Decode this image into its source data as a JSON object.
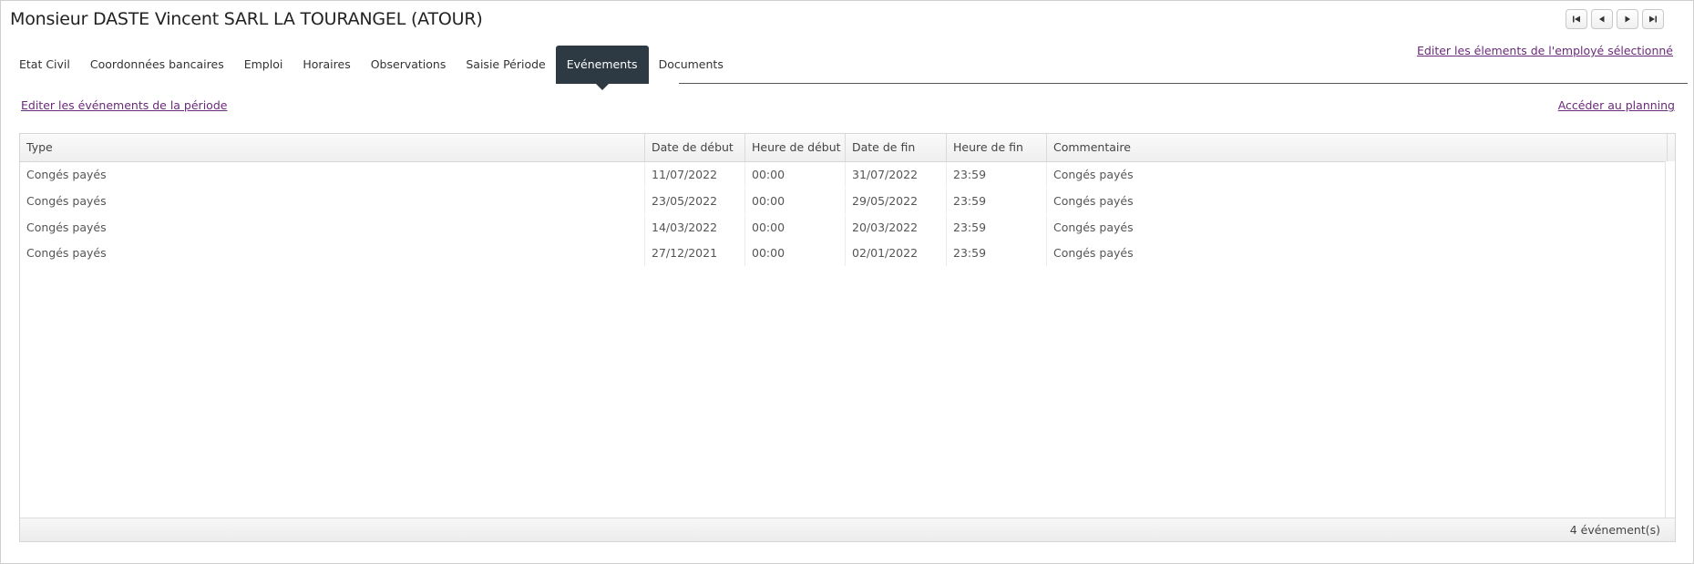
{
  "header": {
    "title": "Monsieur DASTE Vincent SARL LA TOURANGEL (ATOUR)"
  },
  "nav_buttons": [
    "first-icon",
    "previous-icon",
    "next-icon",
    "last-icon"
  ],
  "edit_employee_link": "Editer les élements de l'employé sélectionné",
  "tabs": [
    {
      "label": "Etat Civil"
    },
    {
      "label": "Coordonnées bancaires"
    },
    {
      "label": "Emploi"
    },
    {
      "label": "Horaires"
    },
    {
      "label": "Observations"
    },
    {
      "label": "Saisie Période"
    },
    {
      "label": "Evénements",
      "active": true
    },
    {
      "label": "Documents"
    }
  ],
  "links": {
    "edit_events": "Editer les événements de la période",
    "planning": "Accéder au planning"
  },
  "table": {
    "columns": [
      "Type",
      "Date de début",
      "Heure de début",
      "Date de fin",
      "Heure de fin",
      "Commentaire"
    ],
    "rows": [
      [
        "Congés payés",
        "11/07/2022",
        "00:00",
        "31/07/2022",
        "23:59",
        "Congés payés"
      ],
      [
        "Congés payés",
        "23/05/2022",
        "00:00",
        "29/05/2022",
        "23:59",
        "Congés payés"
      ],
      [
        "Congés payés",
        "14/03/2022",
        "00:00",
        "20/03/2022",
        "23:59",
        "Congés payés"
      ],
      [
        "Congés payés",
        "27/12/2021",
        "00:00",
        "02/01/2022",
        "23:59",
        "Congés payés"
      ]
    ],
    "footer_count": "4 événement(s)"
  },
  "colors": {
    "link": "#6a2a7a",
    "active_tab": "#2d3a44"
  }
}
